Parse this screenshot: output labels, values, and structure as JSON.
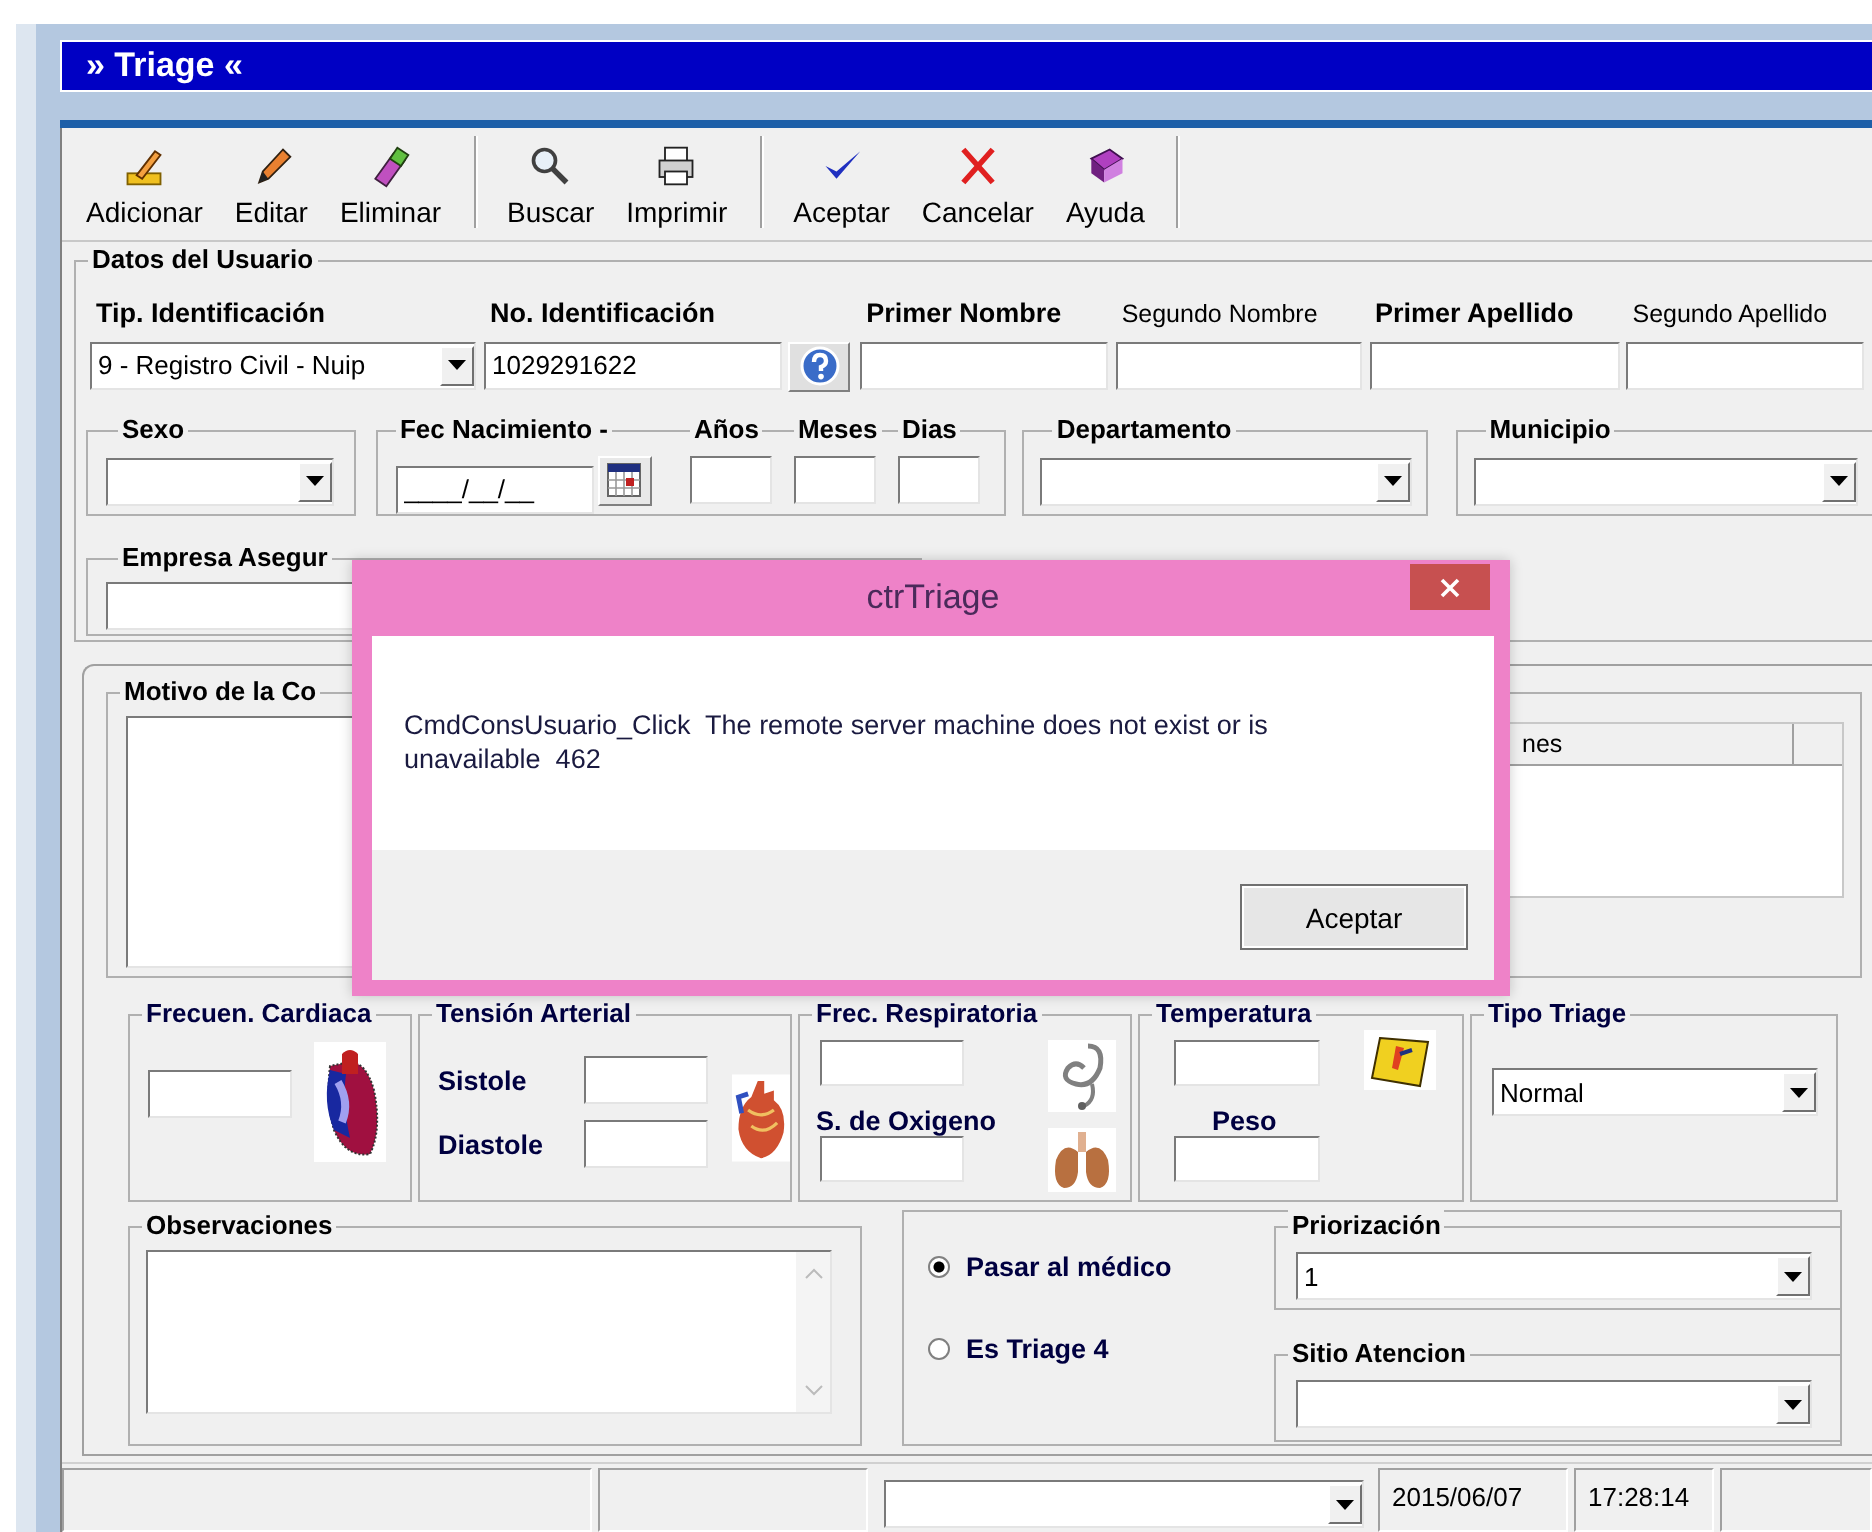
{
  "window": {
    "title": "» Triage «"
  },
  "toolbar": [
    [
      {
        "label": "Adicionar",
        "kind": "add"
      },
      {
        "label": "Editar",
        "kind": "edit"
      },
      {
        "label": "Eliminar",
        "kind": "delete"
      }
    ],
    [
      {
        "label": "Buscar",
        "kind": "search"
      },
      {
        "label": "Imprimir",
        "kind": "print"
      }
    ],
    [
      {
        "label": "Aceptar",
        "kind": "accept"
      },
      {
        "label": "Cancelar",
        "kind": "cancel"
      },
      {
        "label": "Ayuda",
        "kind": "help"
      }
    ]
  ],
  "user_data": {
    "title": "Datos del Usuario",
    "fields": [
      {
        "label": "Tip. Identificación",
        "required": true,
        "kind": "combo",
        "value": "9 - Registro Civil - Nuip"
      },
      {
        "label": "No. Identificación",
        "required": true,
        "kind": "text",
        "value": "1029291622"
      },
      {
        "kind": "help_button"
      },
      {
        "label": "Primer Nombre",
        "required": true,
        "kind": "text"
      },
      {
        "label": "Segundo Nombre",
        "required": false,
        "kind": "text"
      },
      {
        "label": "Primer Apellido",
        "required": true,
        "kind": "text"
      },
      {
        "label": "Segundo Apellido",
        "required": false,
        "kind": "text"
      }
    ],
    "sexo": {
      "title": "Sexo"
    },
    "birth": {
      "title": "Fec Nacimiento -",
      "value": "____/__/__",
      "parts": [
        "Años",
        "Meses",
        "Dias"
      ]
    },
    "departamento": {
      "title": "Departamento"
    },
    "municipio": {
      "title": "Municipio"
    },
    "insurer": {
      "title": "Empresa Asegur"
    }
  },
  "reason": {
    "title": "Motivo de la Co"
  },
  "list": {
    "columns": [
      "nes"
    ]
  },
  "vitals": {
    "heart_rate": {
      "title": "Frecuen. Cardiaca"
    },
    "blood_pressure": {
      "title": "Tensión Arterial",
      "fields": [
        "Sistole",
        "Diastole"
      ]
    },
    "respiratory": {
      "title": "Frec. Respiratoria",
      "second": "S. de Oxigeno"
    },
    "temperature": {
      "title": "Temperatura",
      "second": "Peso"
    },
    "triage_type": {
      "title": "Tipo Triage",
      "value": "Normal"
    }
  },
  "observations": {
    "title": "Observaciones"
  },
  "options": [
    {
      "label": "Pasar al médico",
      "selected": true
    },
    {
      "label": "Es Triage 4",
      "selected": false
    }
  ],
  "priority": {
    "title": "Priorización",
    "value": "1"
  },
  "site": {
    "title": "Sitio Atencion"
  },
  "status_bar": {
    "date": "2015/06/07",
    "time": "17:28:14"
  },
  "dialog": {
    "title": "ctrTriage",
    "message": "CmdConsUsuario_Click  The remote server machine does not exist or is unavailable  462",
    "button": "Aceptar"
  }
}
